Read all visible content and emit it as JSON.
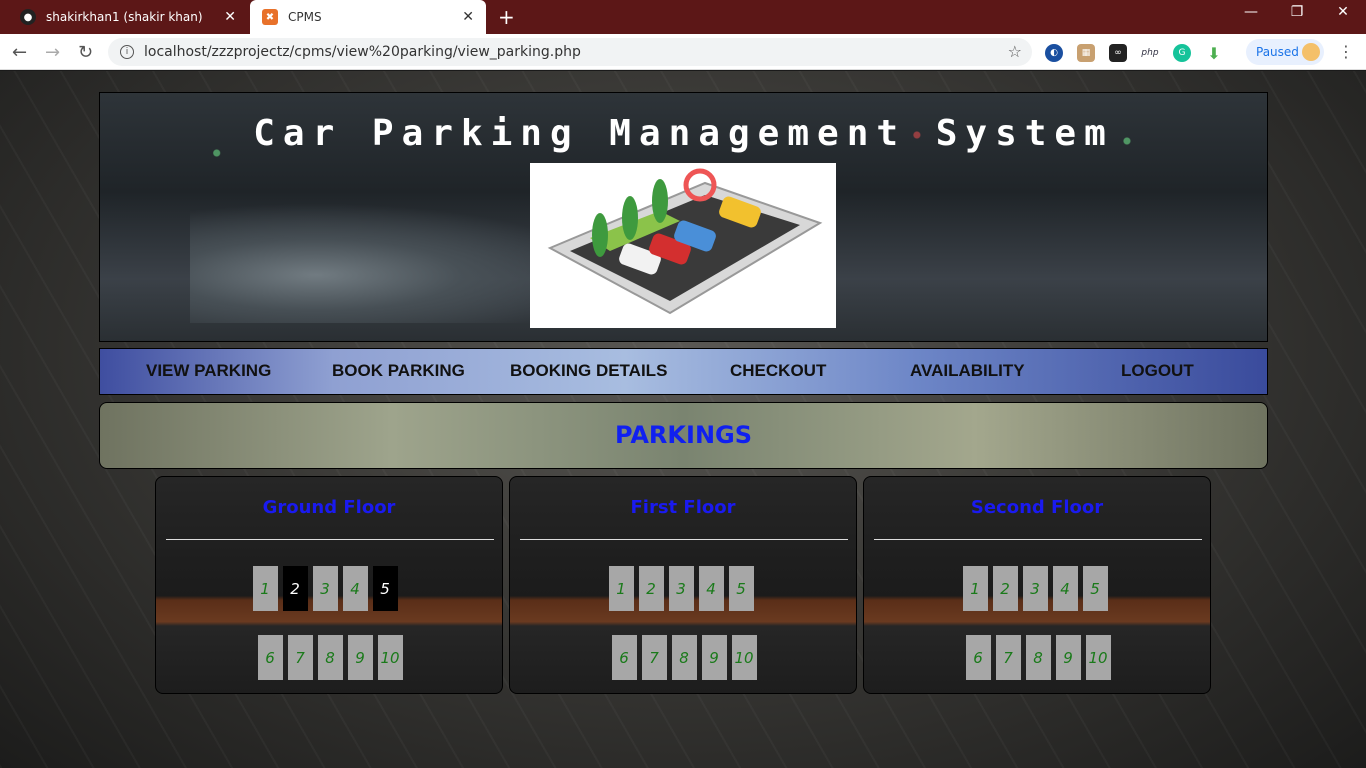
{
  "browser": {
    "tabs": [
      {
        "title": "shakirkhan1 (shakir khan)",
        "icon": "github-icon"
      },
      {
        "title": "CPMS",
        "icon": "xampp-icon"
      }
    ],
    "url": "localhost/zzzprojectz/cpms/view%20parking/view_parking.php",
    "profile_status": "Paused"
  },
  "header": {
    "title": "Car Parking Management System"
  },
  "nav": {
    "items": [
      "VIEW PARKING",
      "BOOK PARKING",
      "BOOKING DETAILS",
      "CHECKOUT",
      "AVAILABILITY",
      "LOGOUT"
    ]
  },
  "section": {
    "title": "PARKINGS"
  },
  "floors": [
    {
      "name": "Ground Floor",
      "slots": [
        "1",
        "2",
        "3",
        "4",
        "5",
        "6",
        "7",
        "8",
        "9",
        "10"
      ],
      "booked": [
        "2",
        "5"
      ]
    },
    {
      "name": "First Floor",
      "slots": [
        "1",
        "2",
        "3",
        "4",
        "5",
        "6",
        "7",
        "8",
        "9",
        "10"
      ],
      "booked": []
    },
    {
      "name": "Second Floor",
      "slots": [
        "1",
        "2",
        "3",
        "4",
        "5",
        "6",
        "7",
        "8",
        "9",
        "10"
      ],
      "booked": []
    }
  ],
  "colors": {
    "slot_available_text": "#1a7a1a",
    "slot_booked_bg": "#000000",
    "title_blue": "#1020f0"
  }
}
